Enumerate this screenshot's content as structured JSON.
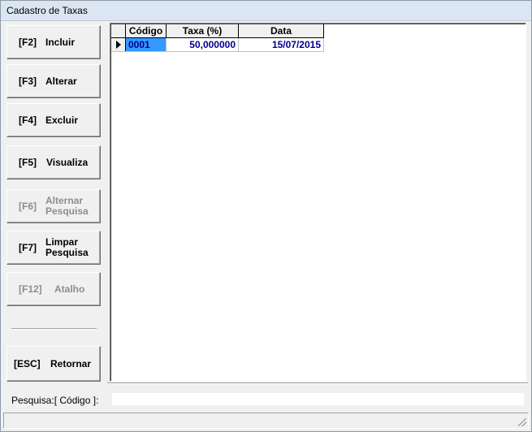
{
  "window": {
    "title": "Cadastro de Taxas"
  },
  "buttons": [
    {
      "key": "[F2]",
      "label": "Incluir",
      "enabled": true
    },
    {
      "key": "[F3]",
      "label": "Alterar",
      "enabled": true
    },
    {
      "key": "[F4]",
      "label": "Excluir",
      "enabled": true
    },
    {
      "key": "[F5]",
      "label": "Visualiza",
      "enabled": true
    },
    {
      "key": "[F6]",
      "label": "Alternar Pesquisa",
      "enabled": false
    },
    {
      "key": "[F7]",
      "label": "Limpar Pesquisa",
      "enabled": true
    },
    {
      "key": "[F12]",
      "label": "Atalho",
      "enabled": false
    },
    {
      "key": "[ESC]",
      "label": "Retornar",
      "enabled": true
    }
  ],
  "grid": {
    "columns": [
      "Código",
      "Taxa (%)",
      "Data"
    ],
    "rows": [
      {
        "codigo": "0001",
        "taxa": "50,000000",
        "data": "15/07/2015"
      }
    ]
  },
  "search": {
    "label": "Pesquisa:[   Código   ]:",
    "value": ""
  },
  "colors": {
    "selection": "#3399ff",
    "data_text": "#00008b"
  }
}
